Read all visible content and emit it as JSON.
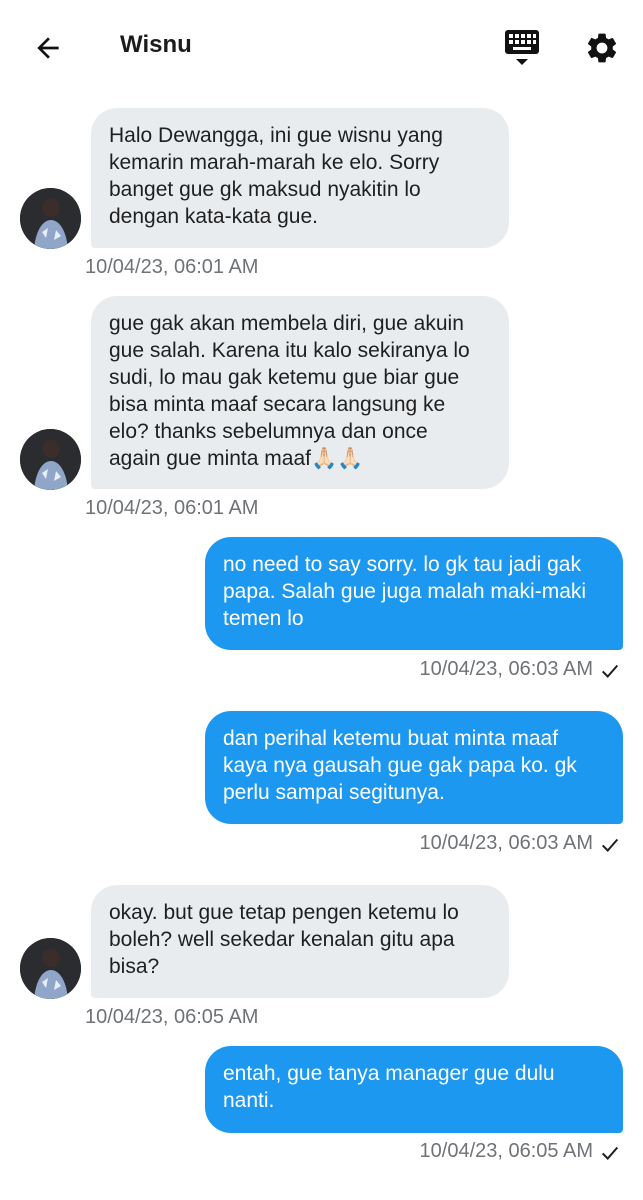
{
  "header": {
    "title": "Wisnu",
    "back_icon": "arrow-left-icon",
    "keyboard_icon": "keyboard-icon",
    "settings_icon": "gear-icon"
  },
  "colors": {
    "incoming_bubble": "#e9ecef",
    "outgoing_bubble": "#1d98f0",
    "timestamp": "#6f7377"
  },
  "messages": [
    {
      "direction": "incoming",
      "text": "Halo Dewangga, ini gue wisnu yang\nkemarin marah-marah ke elo. Sorry\nbanget gue gk maksud nyakitin lo\ndengan kata-kata gue.",
      "time": "10/04/23, 06:01 AM"
    },
    {
      "direction": "incoming",
      "text": "gue gak akan membela diri, gue akuin\ngue salah. Karena itu kalo sekiranya lo\nsudi, lo mau gak ketemu gue biar gue\nbisa minta maaf secara langsung ke\nelo? thanks sebelumnya dan once\nagain gue minta maaf🙏🏻🙏🏻",
      "time": "10/04/23, 06:01 AM"
    },
    {
      "direction": "outgoing",
      "text": "no need to say sorry. lo gk tau jadi gak\npapa. Salah gue juga malah maki-maki\ntemen lo",
      "time": "10/04/23, 06:03 AM",
      "status_icon": "check-icon"
    },
    {
      "direction": "outgoing",
      "text": "dan perihal ketemu buat minta maaf\nkaya nya gausah gue gak papa ko. gk\nperlu sampai segitunya.",
      "time": "10/04/23, 06:03 AM",
      "status_icon": "check-icon"
    },
    {
      "direction": "incoming",
      "text": "okay. but gue tetap pengen ketemu lo\nboleh? well sekedar kenalan gitu apa\nbisa?",
      "time": "10/04/23, 06:05 AM"
    },
    {
      "direction": "outgoing",
      "text": "entah, gue tanya manager gue dulu\nnanti.",
      "time": "10/04/23, 06:05 AM",
      "status_icon": "check-icon"
    }
  ]
}
